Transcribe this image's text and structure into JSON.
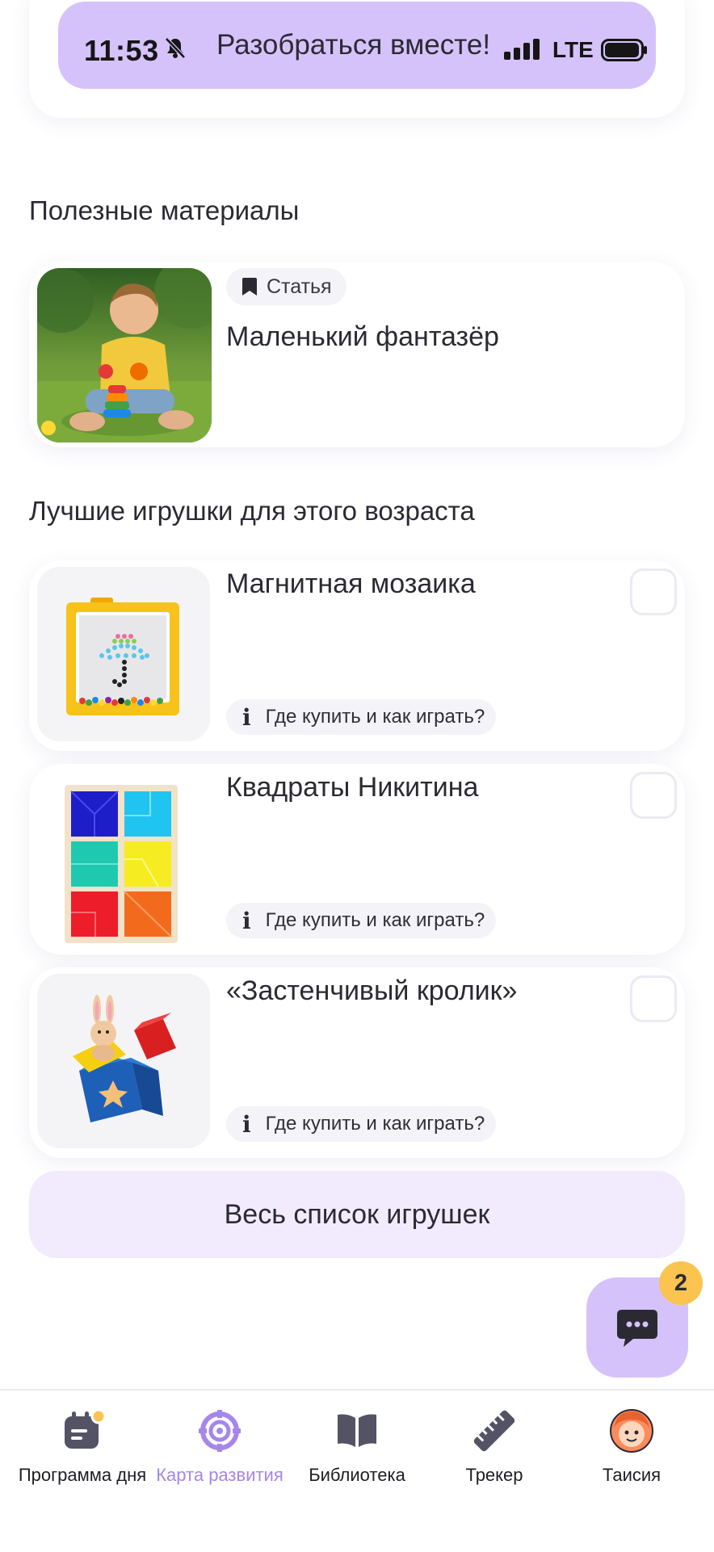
{
  "status_bar": {
    "time": "11:53",
    "network": "LTE"
  },
  "banner": {
    "text": "Разобраться вместе!"
  },
  "materials": {
    "title": "Полезные материалы",
    "article": {
      "tag": "Статья",
      "title": "Маленький фантазёр"
    }
  },
  "toys": {
    "title": "Лучшие игрушки для этого возраста",
    "items": [
      {
        "name": "Магнитная мозаика",
        "link": "Где купить и как играть?"
      },
      {
        "name": "Квадраты Никитина",
        "link": "Где купить и как играть?"
      },
      {
        "name": "«Застенчивый кролик»",
        "link": "Где купить и как играть?"
      }
    ],
    "all_button": "Весь список игрушек"
  },
  "chat": {
    "badge_count": "2"
  },
  "tabbar": {
    "items": [
      {
        "label": "Программа дня",
        "icon": "calendar-icon"
      },
      {
        "label": "Карта развития",
        "icon": "target-icon"
      },
      {
        "label": "Библиотека",
        "icon": "book-icon"
      },
      {
        "label": "Трекер",
        "icon": "ruler-icon"
      },
      {
        "label": "Таисия",
        "icon": "avatar-icon"
      }
    ],
    "active": "Карта развития"
  },
  "colors": {
    "accent": "#d6c2fb",
    "accent_text": "#a686ea",
    "badge": "#fbc451",
    "light_purple": "#f1ebfd"
  }
}
